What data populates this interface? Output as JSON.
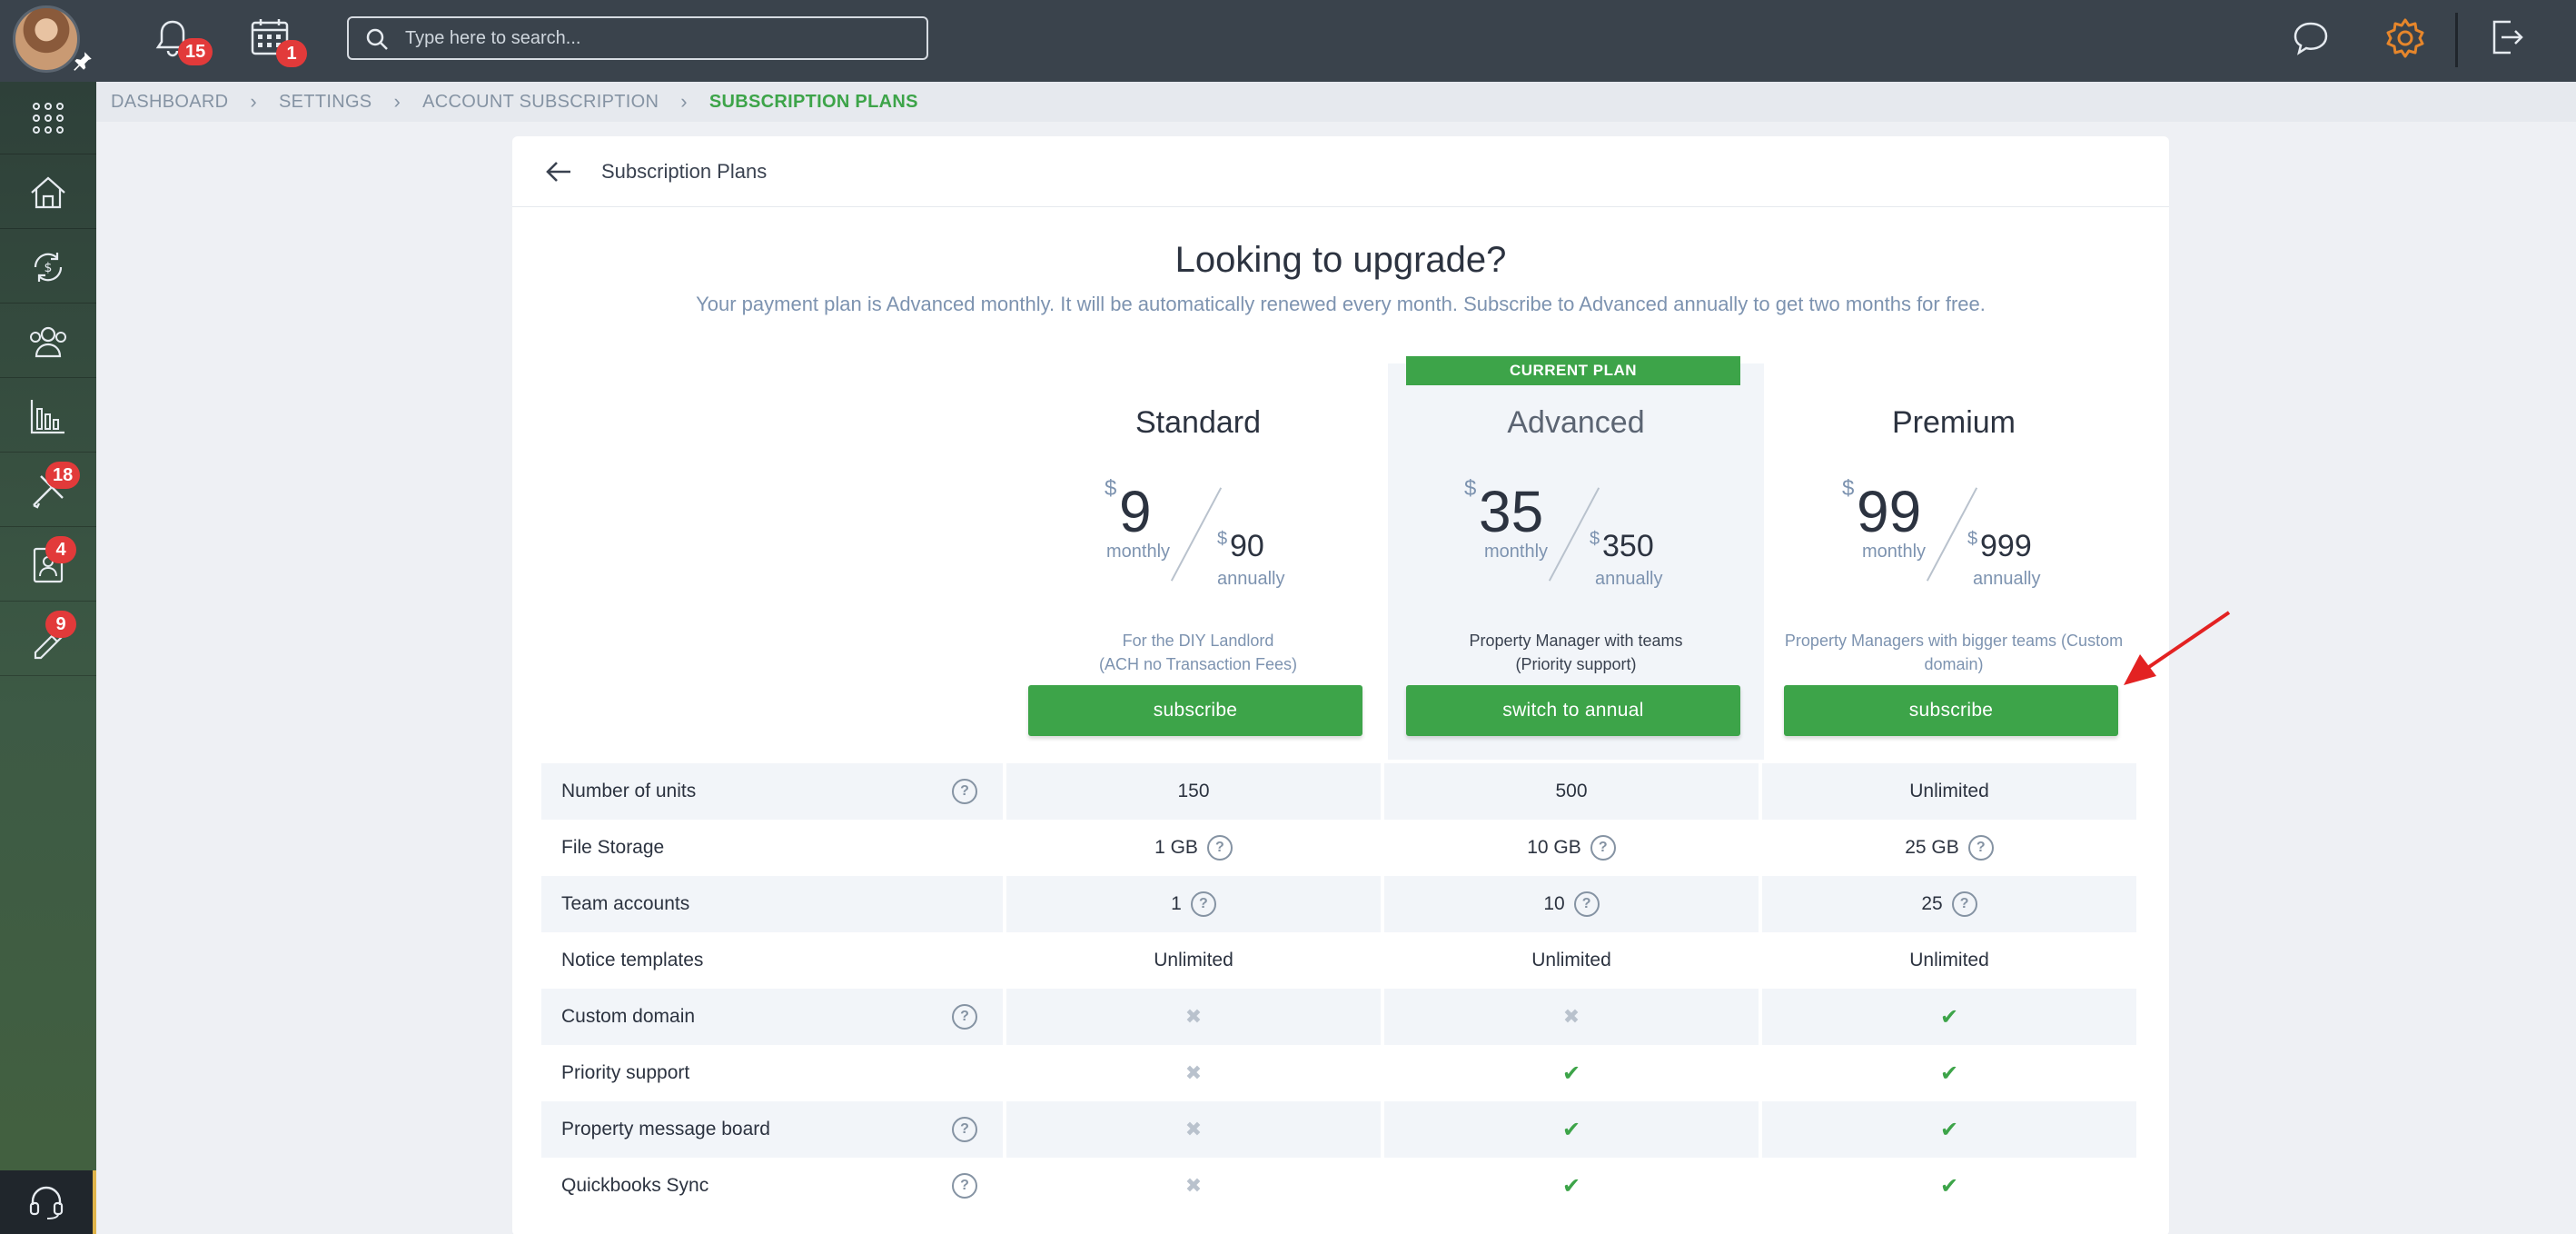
{
  "topbar": {
    "notifications_count": "15",
    "calendar_count": "1",
    "search_placeholder": "Type here to search..."
  },
  "sidebar": {
    "items": [
      {
        "icon": "apps-grid-icon"
      },
      {
        "icon": "property-house-icon"
      },
      {
        "icon": "payments-cycle-icon"
      },
      {
        "icon": "people-icon"
      },
      {
        "icon": "reports-chart-icon"
      },
      {
        "icon": "maintenance-tools-icon",
        "badge": "18"
      },
      {
        "icon": "tenant-screening-icon",
        "badge": "4"
      },
      {
        "icon": "ruler-pencil-icon",
        "badge": "9"
      }
    ]
  },
  "breadcrumb": [
    "DASHBOARD",
    "SETTINGS",
    "ACCOUNT SUBSCRIPTION",
    "SUBSCRIPTION PLANS"
  ],
  "panel": {
    "title": "Subscription Plans",
    "hero_title": "Looking to upgrade?",
    "hero_subtitle": "Your payment plan is Advanced monthly. It will be automatically renewed every month. Subscribe to Advanced annually to get two months for free."
  },
  "plans": [
    {
      "name": "Standard",
      "currency": "$",
      "monthly": "9",
      "monthly_label": "monthly",
      "annual": "90",
      "annual_label": "annually",
      "desc1": "For the DIY Landlord",
      "desc2": "(ACH no Transaction Fees)",
      "button": "subscribe"
    },
    {
      "name": "Advanced",
      "tag": "CURRENT PLAN",
      "currency": "$",
      "monthly": "35",
      "monthly_label": "monthly",
      "annual": "350",
      "annual_label": "annually",
      "desc1": "Property Manager with teams",
      "desc2": "(Priority support)",
      "button": "switch to annual"
    },
    {
      "name": "Premium",
      "currency": "$",
      "monthly": "99",
      "monthly_label": "monthly",
      "annual": "999",
      "annual_label": "annually",
      "desc1": "Property Managers with bigger teams (Custom",
      "desc2": "domain)",
      "button": "subscribe"
    }
  ],
  "features": [
    {
      "name": "Number of units",
      "help": true,
      "values": [
        "150",
        "500",
        "Unlimited"
      ]
    },
    {
      "name": "File Storage",
      "help": false,
      "values": [
        "1 GB",
        "10 GB",
        "25 GB"
      ],
      "value_help": true
    },
    {
      "name": "Team accounts",
      "help": false,
      "values": [
        "1",
        "10",
        "25"
      ],
      "value_help": true
    },
    {
      "name": "Notice templates",
      "help": false,
      "values": [
        "Unlimited",
        "Unlimited",
        "Unlimited"
      ]
    },
    {
      "name": "Custom domain",
      "help": true,
      "values": [
        "no",
        "no",
        "yes"
      ]
    },
    {
      "name": "Priority support",
      "help": false,
      "values": [
        "no",
        "yes",
        "yes"
      ]
    },
    {
      "name": "Property message board",
      "help": true,
      "values": [
        "no",
        "yes",
        "yes"
      ]
    },
    {
      "name": "Quickbooks Sync",
      "help": true,
      "values": [
        "no",
        "yes",
        "yes"
      ]
    }
  ],
  "colors": {
    "accent": "#3da449",
    "badge": "#e23a3a",
    "topbar": "#3a434c",
    "gear": "#e6862b",
    "annotation_arrow": "#e32222"
  }
}
